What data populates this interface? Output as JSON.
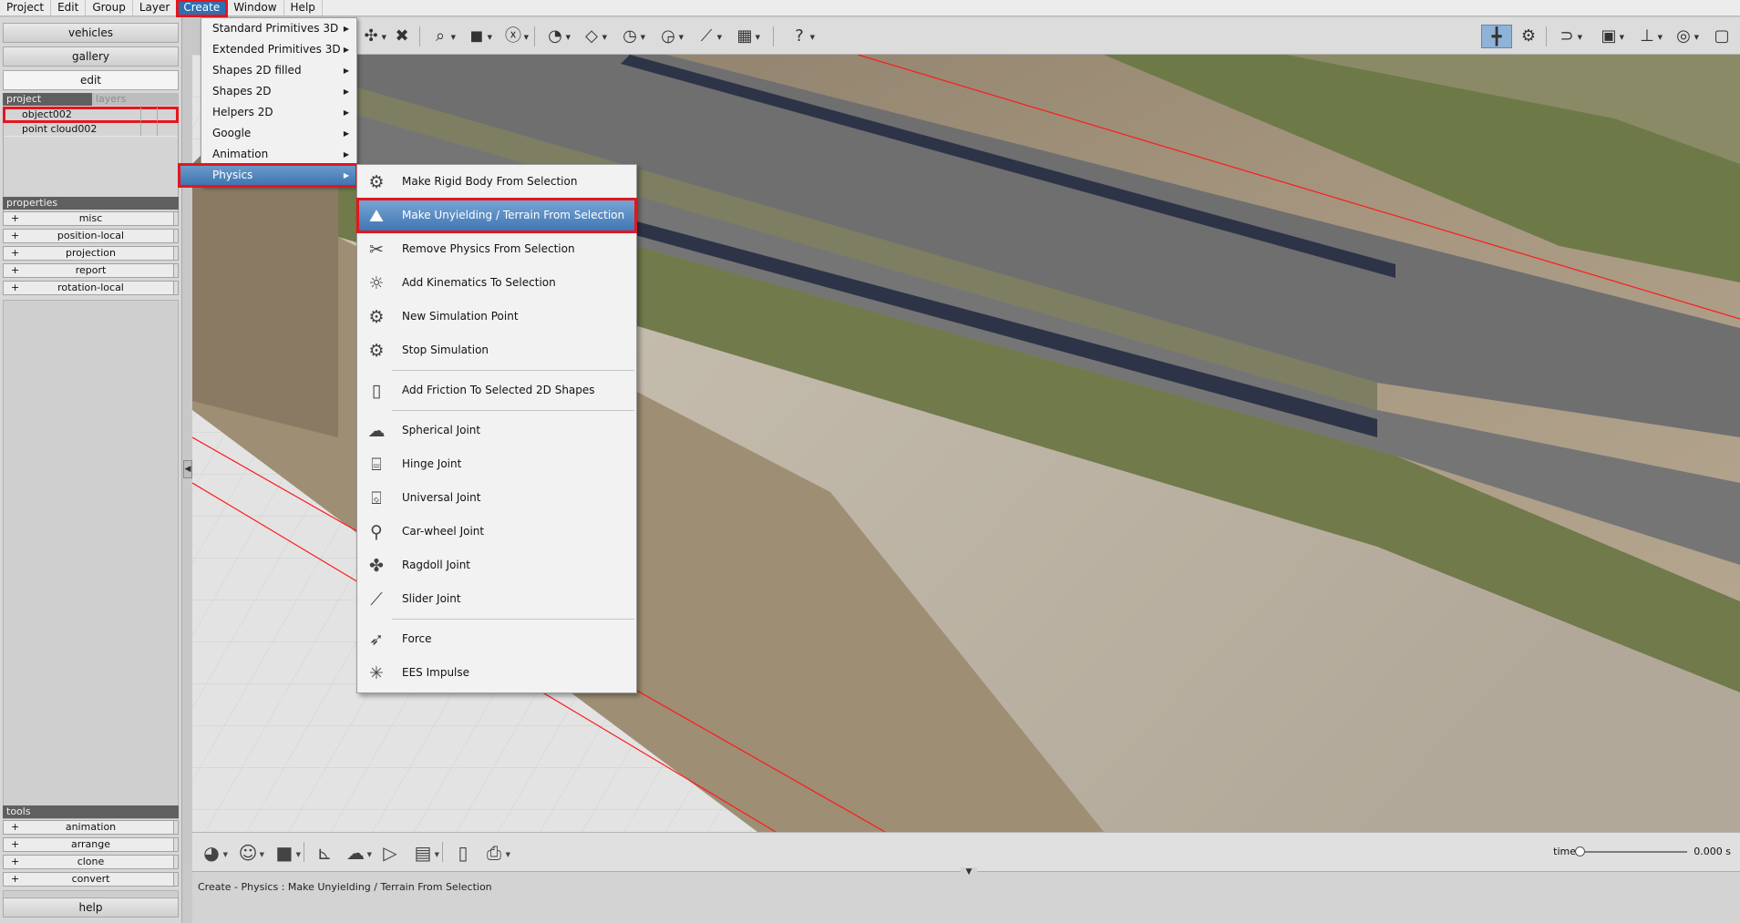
{
  "menubar": {
    "items": [
      {
        "label": "Project"
      },
      {
        "label": "Edit"
      },
      {
        "label": "Group"
      },
      {
        "label": "Layer"
      },
      {
        "label": "Create"
      },
      {
        "label": "Window"
      },
      {
        "label": "Help"
      }
    ],
    "active_index": 4
  },
  "sidebar": {
    "tabs": [
      {
        "label": "vehicles"
      },
      {
        "label": "gallery"
      },
      {
        "label": "edit"
      }
    ],
    "project_header": "project",
    "layers_header": "layers",
    "project_items": [
      {
        "label": "object002"
      },
      {
        "label": "point cloud002"
      }
    ],
    "properties_header": "properties",
    "properties": [
      {
        "label": "misc"
      },
      {
        "label": "position-local"
      },
      {
        "label": "projection"
      },
      {
        "label": "report"
      },
      {
        "label": "rotation-local"
      }
    ],
    "tools_header": "tools",
    "tools": [
      {
        "label": "animation"
      },
      {
        "label": "arrange"
      },
      {
        "label": "clone"
      },
      {
        "label": "convert"
      }
    ],
    "help_label": "help",
    "expand_symbol": "+"
  },
  "create_menu": {
    "items": [
      {
        "label": "Standard Primitives 3D"
      },
      {
        "label": "Extended Primitives 3D"
      },
      {
        "label": "Shapes 2D filled"
      },
      {
        "label": "Shapes 2D"
      },
      {
        "label": "Helpers 2D"
      },
      {
        "label": "Google"
      },
      {
        "label": "Animation"
      },
      {
        "label": "Physics"
      }
    ],
    "active_label": "Physics"
  },
  "physics_menu": {
    "groups": [
      [
        {
          "label": "Make Rigid Body From Selection",
          "icon": "rigid-body-icon"
        },
        {
          "label": "Make Unyielding / Terrain From Selection",
          "icon": "terrain-icon"
        },
        {
          "label": "Remove Physics From Selection",
          "icon": "remove-physics-icon"
        },
        {
          "label": "Add Kinematics To Selection",
          "icon": "kinematics-icon"
        },
        {
          "label": "New Simulation Point",
          "icon": "simulation-point-icon"
        },
        {
          "label": "Stop Simulation",
          "icon": "stop-simulation-icon"
        }
      ],
      [
        {
          "label": "Add Friction To Selected 2D Shapes",
          "icon": "friction-icon"
        }
      ],
      [
        {
          "label": "Spherical Joint",
          "icon": "spherical-joint-icon"
        },
        {
          "label": "Hinge Joint",
          "icon": "hinge-joint-icon"
        },
        {
          "label": "Universal Joint",
          "icon": "universal-joint-icon"
        },
        {
          "label": "Car-wheel Joint",
          "icon": "car-wheel-joint-icon"
        },
        {
          "label": "Ragdoll Joint",
          "icon": "ragdoll-joint-icon"
        },
        {
          "label": "Slider Joint",
          "icon": "slider-joint-icon"
        }
      ],
      [
        {
          "label": "Force",
          "icon": "force-icon"
        },
        {
          "label": "EES Impulse",
          "icon": "impulse-icon"
        }
      ]
    ],
    "active_label": "Make Unyielding / Terrain From Selection"
  },
  "bottom_bar": {
    "time_label": "time",
    "time_value": "0.000 s",
    "time_position": 0
  },
  "status": {
    "text": "Create - Physics : Make Unyielding / Terrain From Selection"
  },
  "colors": {
    "highlight_outline": "#e4161f",
    "menu_active": "#3d73b0"
  }
}
